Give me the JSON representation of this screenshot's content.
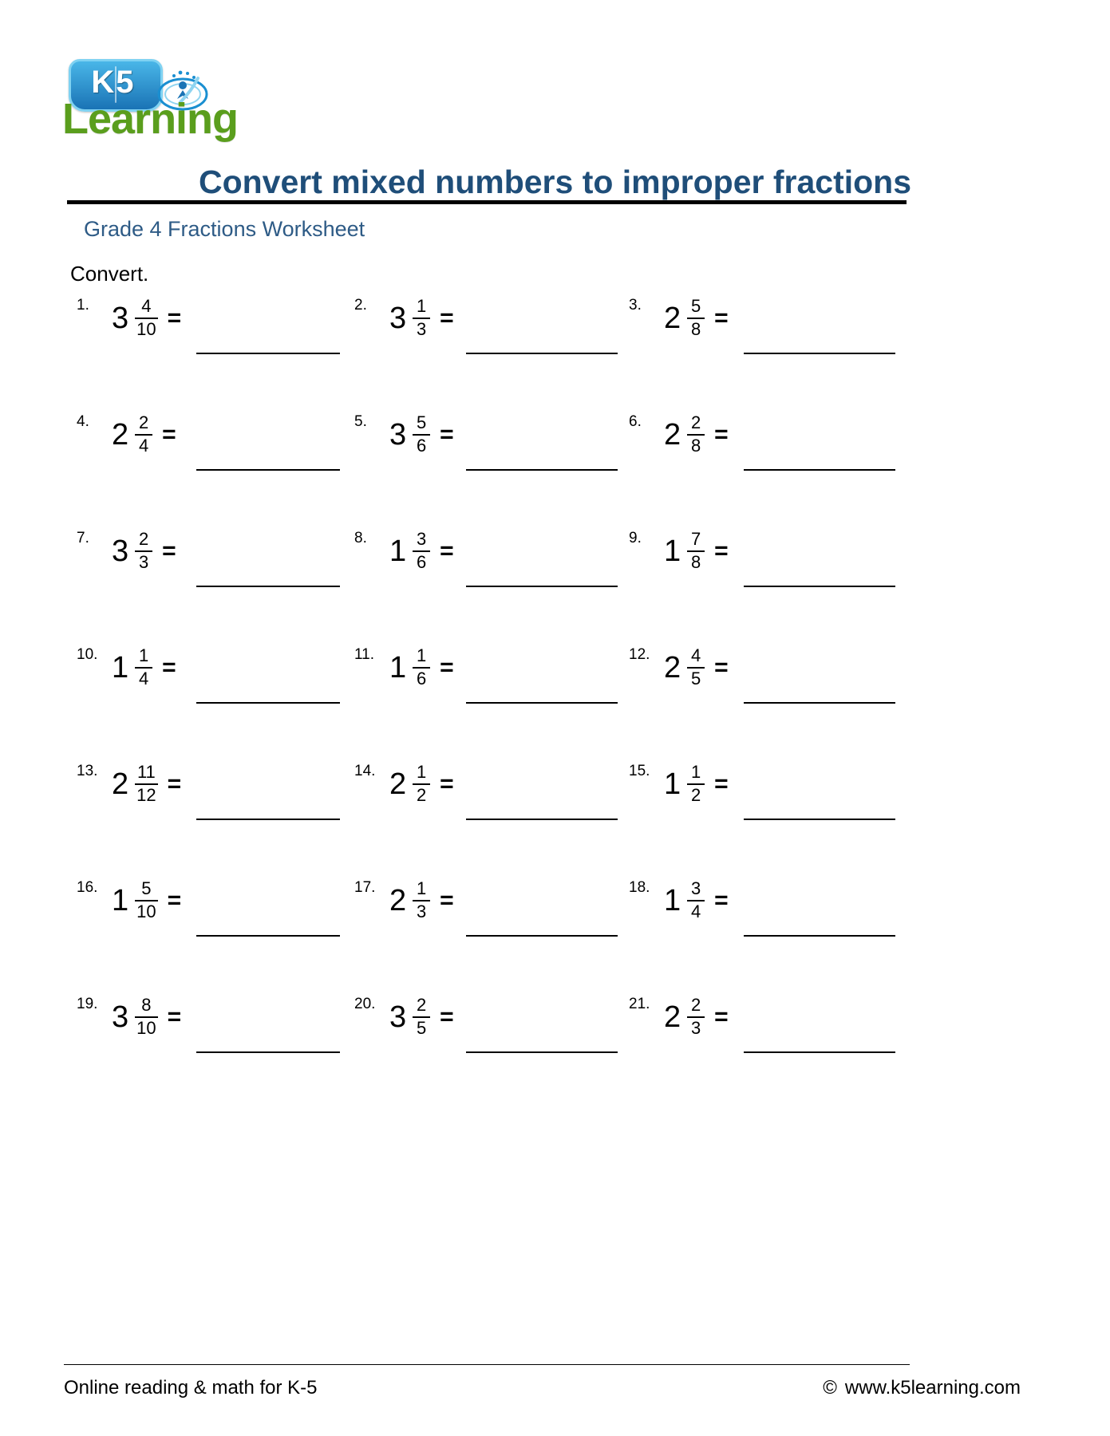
{
  "logo": {
    "badge_text": "K5",
    "word": "Learning",
    "orb_icon": "person-star-orb-icon",
    "badge_color": "#1a73b5",
    "word_color": "#5a9e1d"
  },
  "header": {
    "title": "Convert mixed numbers to improper fractions",
    "subtitle": "Grade 4 Fractions Worksheet",
    "title_color": "#1f4e79",
    "subtitle_color": "#2e5b86"
  },
  "instruction": "Convert.",
  "equals_sign": "=",
  "problems": [
    {
      "num": "1.",
      "whole": "3",
      "numerator": "4",
      "denominator": "10"
    },
    {
      "num": "2.",
      "whole": "3",
      "numerator": "1",
      "denominator": "3"
    },
    {
      "num": "3.",
      "whole": "2",
      "numerator": "5",
      "denominator": "8"
    },
    {
      "num": "4.",
      "whole": "2",
      "numerator": "2",
      "denominator": "4"
    },
    {
      "num": "5.",
      "whole": "3",
      "numerator": "5",
      "denominator": "6"
    },
    {
      "num": "6.",
      "whole": "2",
      "numerator": "2",
      "denominator": "8"
    },
    {
      "num": "7.",
      "whole": "3",
      "numerator": "2",
      "denominator": "3"
    },
    {
      "num": "8.",
      "whole": "1",
      "numerator": "3",
      "denominator": "6"
    },
    {
      "num": "9.",
      "whole": "1",
      "numerator": "7",
      "denominator": "8"
    },
    {
      "num": "10.",
      "whole": "1",
      "numerator": "1",
      "denominator": "4"
    },
    {
      "num": "11.",
      "whole": "1",
      "numerator": "1",
      "denominator": "6"
    },
    {
      "num": "12.",
      "whole": "2",
      "numerator": "4",
      "denominator": "5"
    },
    {
      "num": "13.",
      "whole": "2",
      "numerator": "11",
      "denominator": "12"
    },
    {
      "num": "14.",
      "whole": "2",
      "numerator": "1",
      "denominator": "2"
    },
    {
      "num": "15.",
      "whole": "1",
      "numerator": "1",
      "denominator": "2"
    },
    {
      "num": "16.",
      "whole": "1",
      "numerator": "5",
      "denominator": "10"
    },
    {
      "num": "17.",
      "whole": "2",
      "numerator": "1",
      "denominator": "3"
    },
    {
      "num": "18.",
      "whole": "1",
      "numerator": "3",
      "denominator": "4"
    },
    {
      "num": "19.",
      "whole": "3",
      "numerator": "8",
      "denominator": "10"
    },
    {
      "num": "20.",
      "whole": "3",
      "numerator": "2",
      "denominator": "5"
    },
    {
      "num": "21.",
      "whole": "2",
      "numerator": "2",
      "denominator": "3"
    }
  ],
  "footer": {
    "left": "Online reading & math for K-5",
    "copyright": "©",
    "site": "www.k5learning.com"
  }
}
